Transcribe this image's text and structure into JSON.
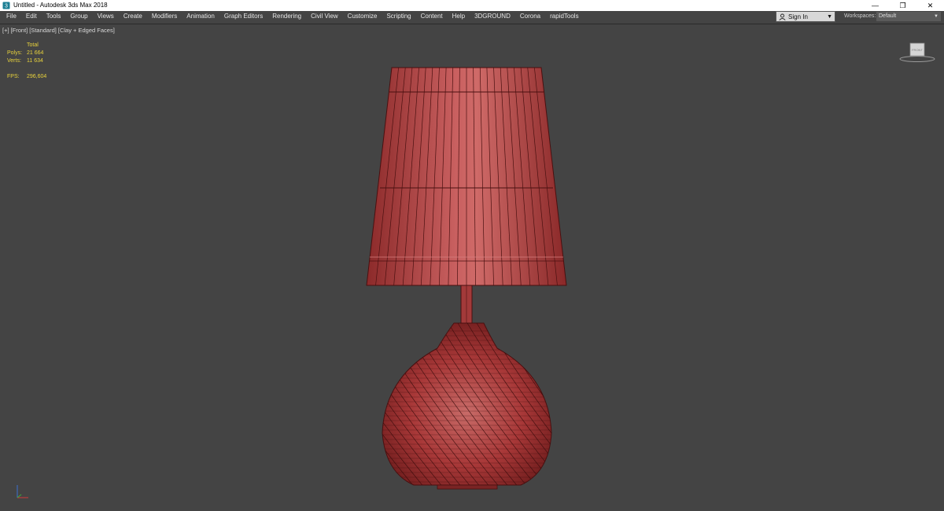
{
  "window": {
    "title": "Untitled - Autodesk 3ds Max 2018",
    "app_icon": "3dsmax-icon",
    "controls": {
      "minimize": "—",
      "restore": "❐",
      "close": "✕"
    }
  },
  "menubar": {
    "items": [
      "File",
      "Edit",
      "Tools",
      "Group",
      "Views",
      "Create",
      "Modifiers",
      "Animation",
      "Graph Editors",
      "Rendering",
      "Civil View",
      "Customize",
      "Scripting",
      "Content",
      "Help",
      "3DGROUND",
      "Corona",
      "rapidTools"
    ],
    "sign_in": "Sign In",
    "workspaces_label": "Workspaces:",
    "workspace_value": "Default"
  },
  "viewport": {
    "label_parts": [
      "[+]",
      "[Front]",
      "[Standard]",
      "[Clay + Edged Faces]"
    ],
    "stats": {
      "total_label": "Total",
      "polys_label": "Polys:",
      "polys_value": "21 664",
      "verts_label": "Verts:",
      "verts_value": "11 634",
      "fps_label": "FPS:",
      "fps_value": "296,604"
    },
    "viewcube_label": "FRONT",
    "colors": {
      "background": "#444444",
      "model_fill": "#b3403f",
      "model_wire": "#4a1010",
      "stats_text": "#e8d23c"
    }
  }
}
